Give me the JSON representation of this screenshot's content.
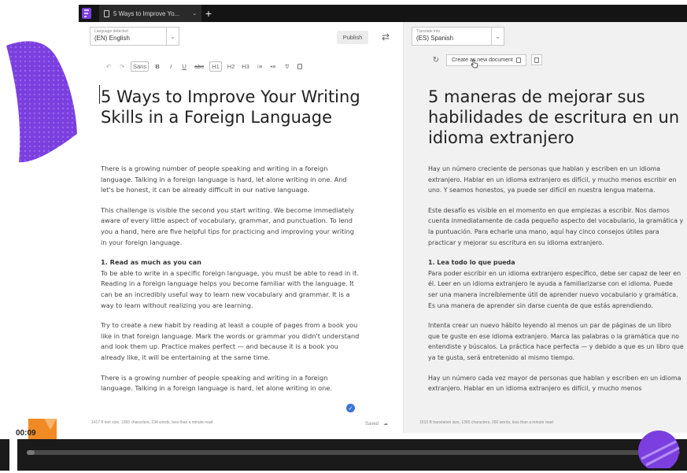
{
  "tab": {
    "title": "5 Ways to Improve Yo..."
  },
  "source": {
    "language_caption": "Language detected",
    "language_value": "(EN) English",
    "publish_label": "Publish",
    "toolbar": [
      "Sans",
      "B",
      "I",
      "U",
      "abc",
      "H1",
      "H2",
      "H3"
    ],
    "title": "5 Ways to Improve Your Writing Skills in a Foreign Language",
    "paragraphs": [
      "There is a growing number of people speaking and writing in a foreign language. Talking in a foreign language is hard, let alone writing in one. And let's be honest, it can be already difficult in our native language.",
      "This challenge is visible the second you start writing. We become immediately aware of every little aspect of vocabulary, grammar, and punctuation. To lend you a hand, here are five helpful tips for practicing and improving your writing in your foreign language."
    ],
    "heading_1": "1. Read as much as you can",
    "paragraphs_2": [
      "To be able to write in a specific foreign language, you must be able to read in it. Reading in a foreign language helps you become familiar with the language. It can be an incredibly useful way to learn new vocabulary and grammar. It is a way to learn without realizing you are learning.",
      "Try to create a new habit by reading at least a couple of pages from a book you like in that foreign language. Mark the words or grammar you didn't understand and look them up. Practice makes perfect — and because it is a book you already like, it will be entertaining at the same time.",
      "There is a growing number of people speaking and writing in a foreign language. Talking in a foreign language is hard, let alone writing in one."
    ],
    "status": "1417 8 text size, 1283 characters, 234 words, less than a minute read",
    "saved": "Saved"
  },
  "target": {
    "language_caption": "Translate into",
    "language_value": "(ES) Spanish",
    "create_label": "Create as new document",
    "title": "5 maneras de mejorar sus habilidades de escritura en un idioma extranjero",
    "paragraphs": [
      "Hay un número creciente de personas que hablan y escriben en un idioma extranjero. Hablar en un idioma extranjero es difícil, y mucho menos escribir en uno. Y seamos honestos, ya puede ser difícil en nuestra lengua materna.",
      "Este desafío es visible en el momento en que empiezas a escribir. Nos damos cuenta inmediatamente de cada pequeño aspecto del vocabulario, la gramática y la puntuación. Para echarle una mano, aquí hay cinco consejos útiles para practicar y mejorar su escritura en su idioma extranjero."
    ],
    "heading_1": "1. Lea todo lo que pueda",
    "paragraphs_2": [
      "Para poder escribir en un idioma extranjero específico, debe ser capaz de leer en él. Leer en un idioma extranjero le ayuda a familiarizarse con el idioma. Puede ser una manera increíblemente útil de aprender nuevo vocabulario y gramática. Es una manera de aprender sin darse cuenta de que estás aprendiendo.",
      "Intenta crear un nuevo hábito leyendo al menos un par de páginas de un libro que te guste en ese idioma extranjero. Marca las palabras o la gramática que no entendiste y búscalos. La práctica hace perfecta — y debido a que es un libro que ya te gusta, será entretenido al mismo tiempo.",
      "Hay un número cada vez mayor de personas que hablan y escriben en un idioma extranjero. Hablar en un idioma extranjero es difícil, y mucho menos"
    ],
    "status": "1510 B translation size, 1365 characters, 250 words, less than a minute read"
  },
  "video": {
    "time": "00:09",
    "progress_fraction": 0.012
  },
  "colors": {
    "accent_purple": "#7b3fe0",
    "accent_orange": "#f08a24",
    "check_blue": "#3a73d8"
  }
}
